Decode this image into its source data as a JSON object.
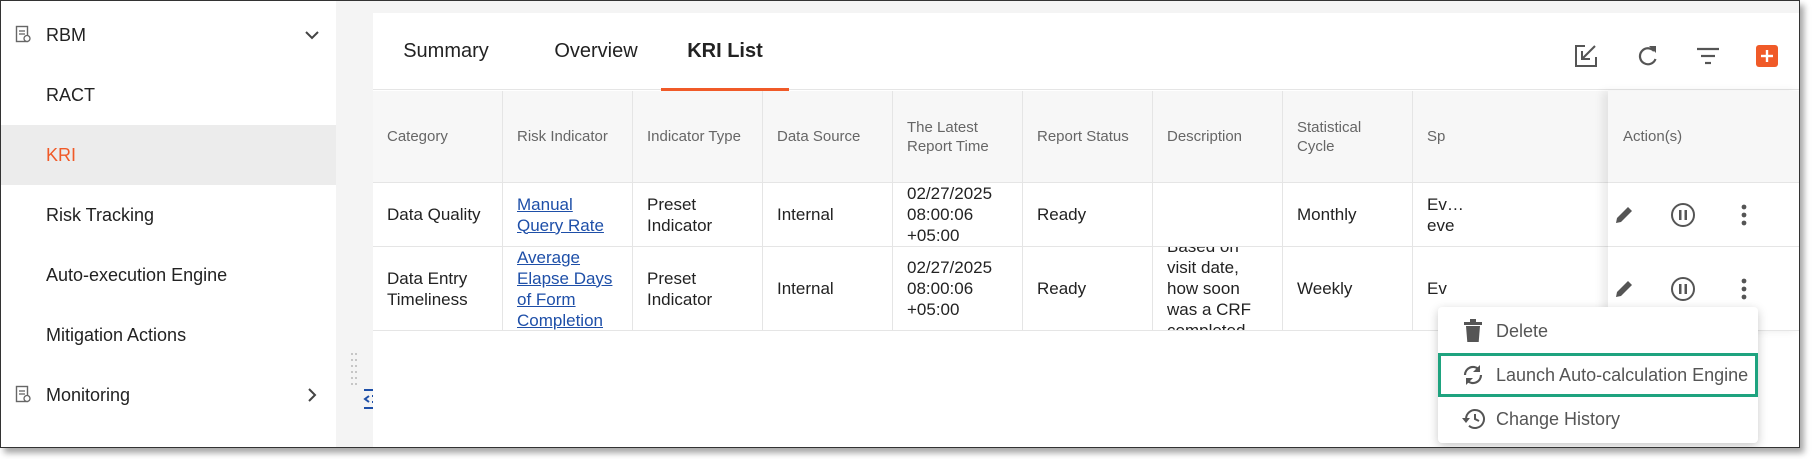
{
  "sidebar": {
    "items": [
      {
        "label": "RBM",
        "icon": "report-icon",
        "expanded": true
      },
      {
        "label": "RACT"
      },
      {
        "label": "KRI",
        "active": true
      },
      {
        "label": "Risk Tracking"
      },
      {
        "label": "Auto-execution Engine"
      },
      {
        "label": "Mitigation Actions"
      },
      {
        "label": "Monitoring",
        "icon": "report-icon",
        "expanded": false
      }
    ]
  },
  "tabs": [
    {
      "label": "Summary"
    },
    {
      "label": "Overview"
    },
    {
      "label": "KRI List",
      "active": true
    }
  ],
  "toolbar": {
    "icons": [
      "export-icon",
      "refresh-icon",
      "filter-icon",
      "add-icon"
    ]
  },
  "table": {
    "headers": [
      "Category",
      "Risk Indicator",
      "Indicator Type",
      "Data Source",
      "The Latest Report Time",
      "Report Status",
      "Description",
      "Statistical Cycle",
      "Sp",
      "Action(s)"
    ],
    "rows": [
      {
        "category": "Data Quality",
        "risk_indicator": "Manual Query Rate",
        "indicator_type": "Preset Indicator",
        "data_source": "Internal",
        "latest_report_time": "02/27/2025 08:00:06 +05:00",
        "report_status": "Ready",
        "description": "",
        "statistical_cycle": "Monthly",
        "sp": "Ev… eve"
      },
      {
        "category": "Data Entry Timeliness",
        "risk_indicator": "Average Elapse Days of Form Completion",
        "indicator_type": "Preset Indicator",
        "data_source": "Internal",
        "latest_report_time": "02/27/2025 08:00:06 +05:00",
        "report_status": "Ready",
        "description": "Based on visit date, how soon was a CRF completed",
        "statistical_cycle": "Weekly",
        "sp": "Ev"
      }
    ]
  },
  "row_actions": [
    "edit-icon",
    "pause-icon",
    "more-vertical-icon"
  ],
  "menu": {
    "items": [
      {
        "label": "Delete",
        "icon": "trash-icon"
      },
      {
        "label": "Launch Auto-calculation Engine",
        "icon": "sync-icon",
        "highlighted": true
      },
      {
        "label": "Change History",
        "icon": "history-icon"
      }
    ]
  },
  "colors": {
    "accent": "#f05a28",
    "link": "#1e4fa8",
    "highlight_border": "#1ea37f",
    "active_nav_bg": "#ececec"
  }
}
